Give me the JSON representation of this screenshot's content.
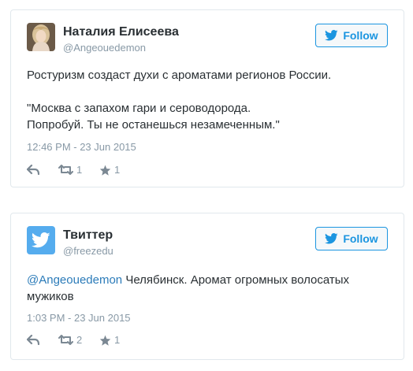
{
  "tweets": [
    {
      "author_name": "Наталия Елисеева",
      "author_handle": "@Angeouedemon",
      "avatar_icon": "user-photo-avatar",
      "follow_label": "Follow",
      "text": "Ростуризм создаст духи с ароматами регионов России.\n\n\"Москва  с запахом гари и  сероводорода.\nПопробуй. Ты не останешься незамеченным.\"",
      "timestamp": "12:46 PM - 23 Jun 2015",
      "retweets": "1",
      "likes": "1"
    },
    {
      "author_name": "Твиттер",
      "author_handle": "@freezedu",
      "avatar_icon": "twitter-bird-avatar",
      "follow_label": "Follow",
      "mention": "@Angeouedemon",
      "text": " Челябинск. Аромат огромных волосатых мужиков",
      "timestamp": "1:03 PM - 23 Jun 2015",
      "retweets": "2",
      "likes": "1"
    }
  ],
  "colors": {
    "accent": "#1b95e0",
    "text": "#292f33",
    "muted": "#8899a6",
    "mention": "#2b7bb9",
    "border": "#e1e8ed"
  }
}
